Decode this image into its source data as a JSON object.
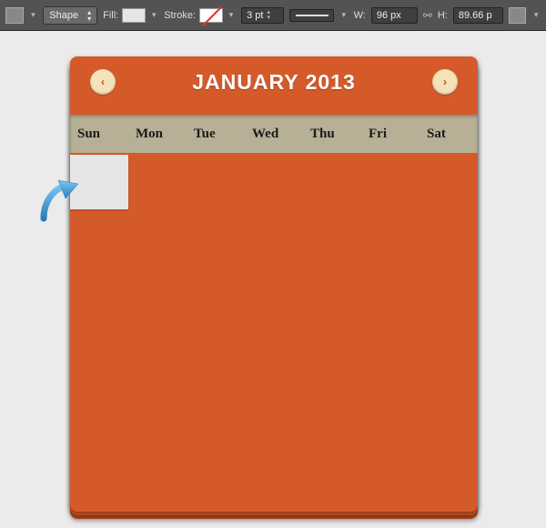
{
  "optionsBar": {
    "shapeLabel": "Shape",
    "fillLabel": "Fill:",
    "strokeLabel": "Stroke:",
    "strokeWidth": "3 pt",
    "wLabel": "W:",
    "wValue": "96 px",
    "hLabel": "H:",
    "hValue": "89.66 p"
  },
  "calendar": {
    "title": "JANUARY 2013",
    "days": [
      "Sun",
      "Mon",
      "Tue",
      "Wed",
      "Thu",
      "Fri",
      "Sat"
    ]
  }
}
